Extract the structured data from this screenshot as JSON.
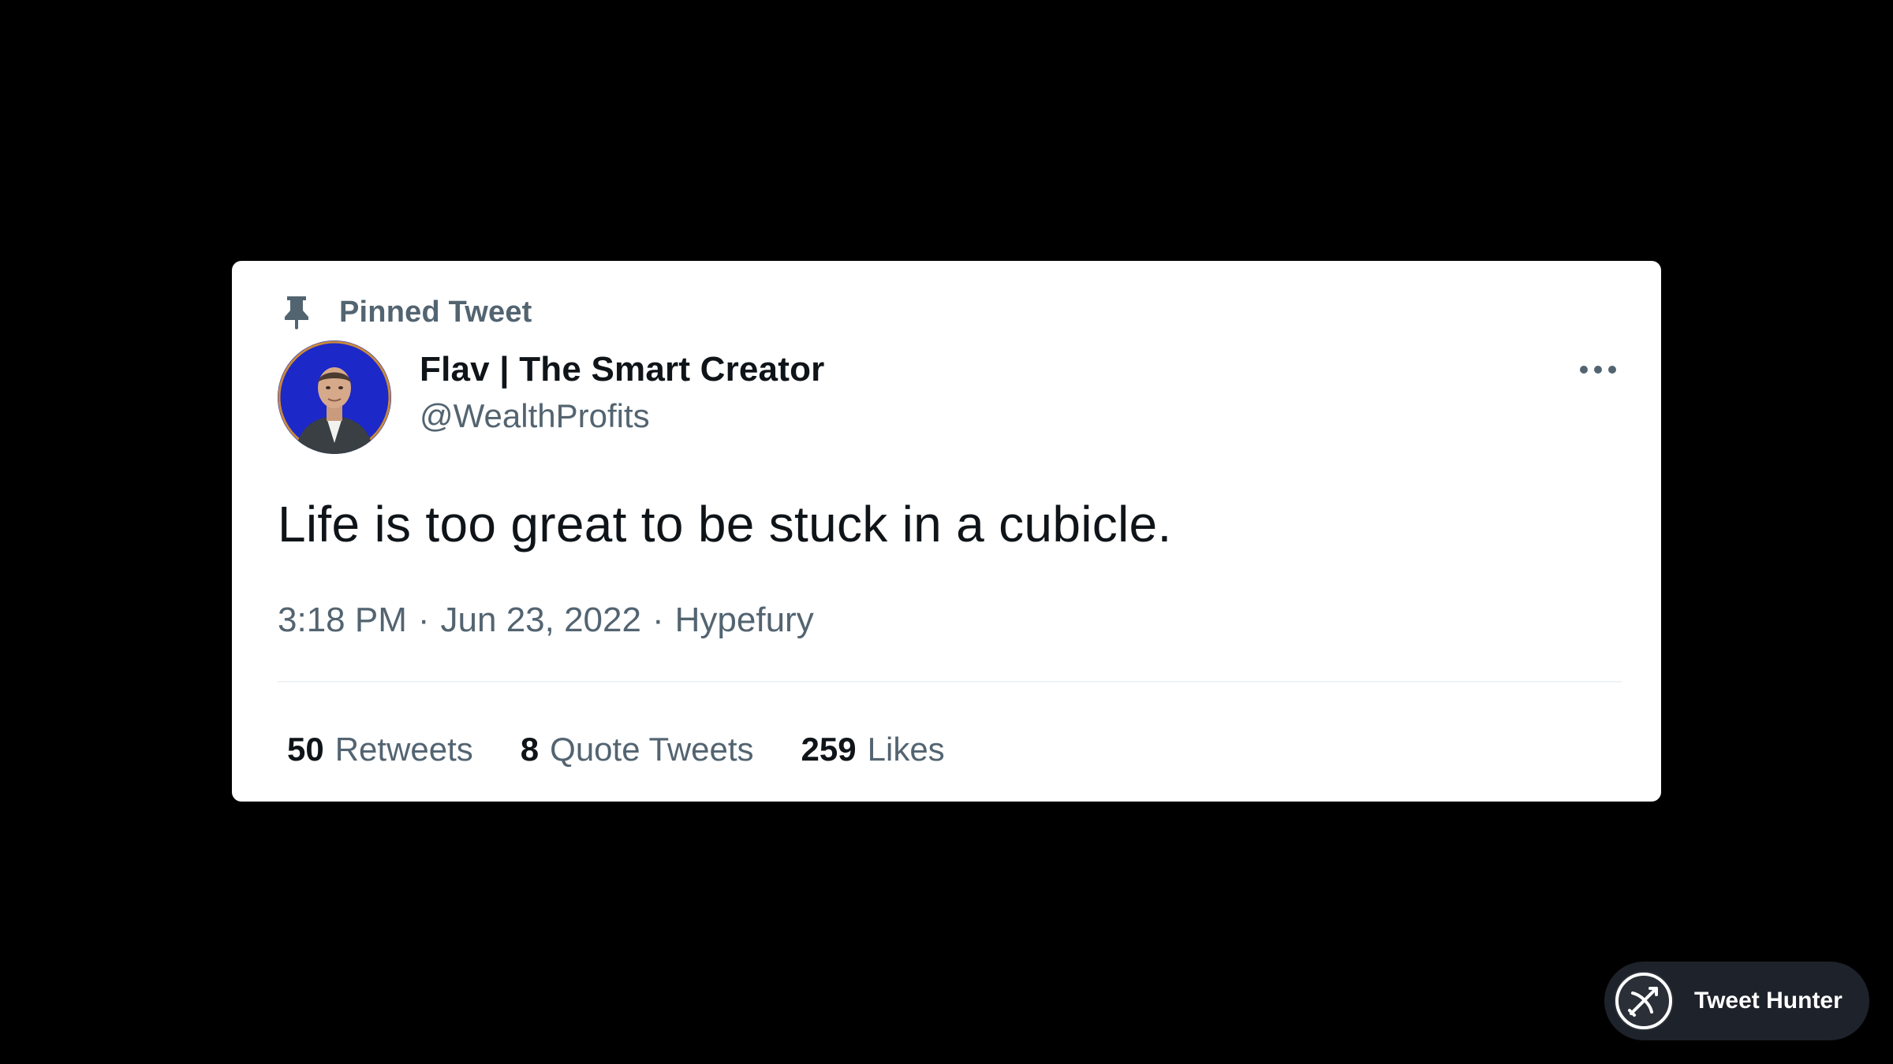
{
  "tweet": {
    "pinned_label": "Pinned Tweet",
    "author_name": "Flav | The Smart Creator",
    "author_handle": "@WealthProfits",
    "text": "Life is too great to be stuck in a cubicle.",
    "time": "3:18 PM",
    "date": "Jun 23, 2022",
    "source": "Hypefury",
    "separator": "·",
    "stats": [
      {
        "count": "50",
        "label": "Retweets"
      },
      {
        "count": "8",
        "label": "Quote Tweets"
      },
      {
        "count": "259",
        "label": "Likes"
      }
    ],
    "icons": {
      "pin": "pin-icon",
      "more": "more-horizontal-icon"
    },
    "colors": {
      "text_primary": "#0f1419",
      "text_secondary": "#536471",
      "avatar_bg": "#1d28c8",
      "card_bg": "#ffffff",
      "page_bg": "#000000"
    }
  },
  "watermark": {
    "label": "Tweet Hunter",
    "icon": "bow-arrow-icon"
  }
}
